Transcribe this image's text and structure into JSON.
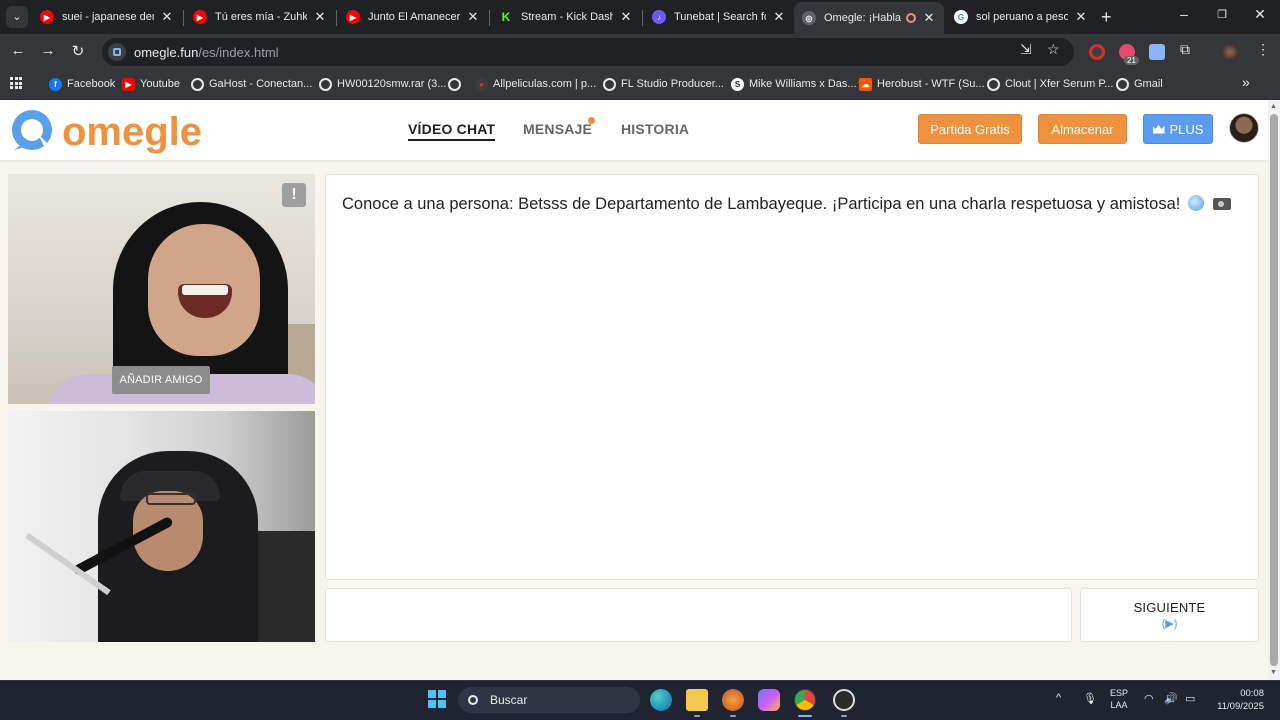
{
  "browser": {
    "tabs": [
      {
        "title": "suei - japanese dem",
        "icon": "youtube-icon",
        "color": "#ff0000"
      },
      {
        "title": "Tú eres mía - Zuhk ft",
        "icon": "youtube-icon",
        "color": "#ff0000"
      },
      {
        "title": "Junto El Amanecer -",
        "icon": "youtube-icon",
        "color": "#ff0000"
      },
      {
        "title": "Stream - Kick Dashbo",
        "icon": "kick-icon",
        "color": "#53fc18"
      },
      {
        "title": "Tunebat | Search for",
        "icon": "tunebat-icon",
        "color": "#6b5bff"
      },
      {
        "title": "Omegle: ¡Habla c",
        "icon": "omegle-icon",
        "color": "#9aa0a6",
        "active": true
      },
      {
        "title": "sol peruano a peso n",
        "icon": "google-icon",
        "color": "#4285f4"
      }
    ],
    "url_host": "omegle.fun",
    "url_path": "/es/index.html",
    "extension_badge": "21",
    "bookmarks": [
      {
        "label": "Facebook",
        "icon": "facebook-icon",
        "color": "#1877f2"
      },
      {
        "label": "Youtube",
        "icon": "youtube-icon",
        "color": "#ff0000"
      },
      {
        "label": "GaHost - Conectan...",
        "icon": "globe-icon",
        "color": "#e8eaed"
      },
      {
        "label": "HW00120smw.rar (3...",
        "icon": "globe-icon",
        "color": "#e8eaed"
      },
      {
        "label": "",
        "icon": "globe-icon",
        "color": "#e8eaed"
      },
      {
        "label": "Allpeliculas.com | p...",
        "icon": "allpeliculas-icon",
        "color": "#d93025"
      },
      {
        "label": "FL Studio Producer...",
        "icon": "globe-icon",
        "color": "#e8eaed"
      },
      {
        "label": "Mike Williams x Das...",
        "icon": "soundcloud-alt-icon",
        "color": "#ffffff"
      },
      {
        "label": "Herobust - WTF (Su...",
        "icon": "soundcloud-icon",
        "color": "#ff5500"
      },
      {
        "label": "Clout | Xfer Serum P...",
        "icon": "globe-icon",
        "color": "#e8eaed"
      },
      {
        "label": "Gmail",
        "icon": "globe-icon",
        "color": "#e8eaed"
      }
    ]
  },
  "site": {
    "logo_text": "omegle",
    "nav": {
      "video_chat": "VÍDEO CHAT",
      "mensaje": "MENSAJE",
      "historia": "HISTORIA"
    },
    "buttons": {
      "partida_gratis": "Partida Gratis",
      "almacenar": "Almacenar",
      "plus": "PLUS"
    },
    "video": {
      "add_friend": "AÑADIR AMIGO",
      "report": "!"
    },
    "chat_message": "Conoce a una persona: Betsss de Departamento de Lambayeque. ¡Participa en una charla respetuosa y amistosa!",
    "next_button": "SIGUIENTE",
    "next_hint": "(▶)"
  },
  "taskbar": {
    "search_label": "Buscar",
    "lang_line1": "ESP",
    "lang_line2": "LAA",
    "time": "00:08",
    "date": "11/09/2025"
  },
  "colors": {
    "accent_orange": "#f0913e",
    "accent_blue": "#5a9cf2",
    "page_bg": "#f8f5ef"
  }
}
